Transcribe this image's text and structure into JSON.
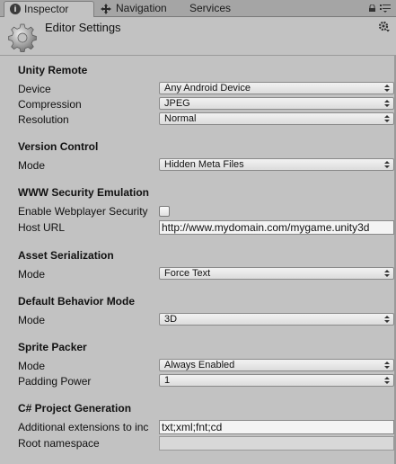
{
  "tabs": [
    {
      "label": "Inspector",
      "icon": "info-icon"
    },
    {
      "label": "Navigation",
      "icon": "navigation-icon"
    },
    {
      "label": "Services"
    }
  ],
  "header": {
    "title": "Editor Settings",
    "icon": "gear-icon"
  },
  "sections": {
    "unity_remote": {
      "title": "Unity Remote",
      "device_label": "Device",
      "device_value": "Any Android Device",
      "compression_label": "Compression",
      "compression_value": "JPEG",
      "resolution_label": "Resolution",
      "resolution_value": "Normal"
    },
    "version_control": {
      "title": "Version Control",
      "mode_label": "Mode",
      "mode_value": "Hidden Meta Files"
    },
    "www_security": {
      "title": "WWW Security Emulation",
      "enable_label": "Enable Webplayer Security",
      "enable_checked": false,
      "host_label": "Host URL",
      "host_value": "http://www.mydomain.com/mygame.unity3d"
    },
    "asset_serialization": {
      "title": "Asset Serialization",
      "mode_label": "Mode",
      "mode_value": "Force Text"
    },
    "default_behavior": {
      "title": "Default Behavior Mode",
      "mode_label": "Mode",
      "mode_value": "3D"
    },
    "sprite_packer": {
      "title": "Sprite Packer",
      "mode_label": "Mode",
      "mode_value": "Always Enabled",
      "padding_label": "Padding Power",
      "padding_value": "1"
    },
    "csharp_project": {
      "title": "C# Project Generation",
      "extensions_label": "Additional extensions to inc",
      "extensions_value": "txt;xml;fnt;cd",
      "namespace_label": "Root namespace",
      "namespace_value": ""
    }
  },
  "colors": {
    "background": "#c2c2c2",
    "tabbar": "#a5a5a5"
  }
}
